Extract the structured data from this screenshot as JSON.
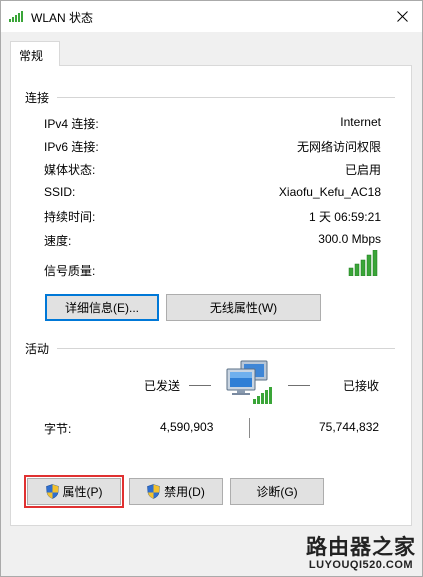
{
  "window": {
    "title": "WLAN 状态",
    "close_glyph": "✕"
  },
  "tabs": [
    {
      "label": "常规",
      "active": true
    }
  ],
  "connection": {
    "section_label": "连接",
    "rows": [
      {
        "label": "IPv4 连接:",
        "value": "Internet"
      },
      {
        "label": "IPv6 连接:",
        "value": "无网络访问权限"
      },
      {
        "label": "媒体状态:",
        "value": "已启用"
      },
      {
        "label": "SSID:",
        "value": "Xiaofu_Kefu_AC18"
      },
      {
        "label": "持续时间:",
        "value": "1 天 06:59:21"
      },
      {
        "label": "速度:",
        "value": "300.0 Mbps"
      }
    ],
    "signal_label": "信号质量:",
    "signal_bars": 5,
    "signal_level": 5,
    "details_button": "详细信息(E)...",
    "wireless_props_button": "无线属性(W)"
  },
  "activity": {
    "section_label": "活动",
    "sent_label": "已发送",
    "received_label": "已接收",
    "bytes_label": "字节:",
    "bytes_sent": "4,590,903",
    "bytes_received": "75,744,832"
  },
  "actions": {
    "properties_button": "属性(P)",
    "disable_button": "禁用(D)",
    "diagnose_button": "诊断(G)"
  },
  "watermark": {
    "title": "路由器之家",
    "url": "LUYOUQI520.COM"
  },
  "colors": {
    "signal_green": "#3aa538",
    "focus_blue": "#0078d7",
    "highlight_red": "#e03131"
  }
}
